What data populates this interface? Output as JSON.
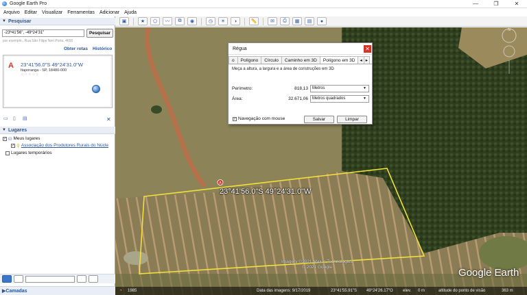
{
  "window": {
    "title": "Google Earth Pro",
    "controls": [
      "—",
      "❐",
      "✕"
    ]
  },
  "menubar": {
    "items": [
      "Arquivo",
      "Editar",
      "Visualizar",
      "Ferramentas",
      "Adicionar",
      "Ajuda"
    ]
  },
  "search": {
    "section_title": "Pesquisar",
    "input_value": "-23º41'56\", -49º24'31\"",
    "button_label": "Pesquisar",
    "hint": "por exemplo., Rua São Filipe Neri Porto, 4650",
    "get_directions": "Obter rotas",
    "history": "Histórico",
    "result": {
      "marker": "A",
      "title": "23°41'56.0\"S 49°24'31.0\"W",
      "address": "Itaporanga - SP, 18480-000",
      "rating_dots": "☆☆☆☆☆"
    }
  },
  "places": {
    "section_title": "Lugares",
    "my_places": "Meus lugares",
    "item": "Associação dos Produtores Rurais do Núcle",
    "temporary": "Lugares temporários"
  },
  "layers": {
    "section_title": "Camadas"
  },
  "map": {
    "coord_label": "23°41'56.0\"S 49°24'31.0\"W",
    "marker": "A",
    "credit_line1": "Imagery ©2021 Maxar Technologies",
    "credit_line2": "© 2021 Google",
    "logo": "Google Earth",
    "status": {
      "year": "1985",
      "image_date": "Data das imagens: 9/17/2019",
      "lat": "23°41'55.91\"S",
      "lon": "49°24'26.17\"O",
      "elev_label": "elev.",
      "elev": "0 m",
      "eye_alt": "altitude do ponto de visão",
      "eye_alt_value": "363 m"
    }
  },
  "ruler_dialog": {
    "title": "Régua",
    "tabs": [
      "o",
      "Polígono",
      "Círculo",
      "Caminho em 3D",
      "Polígono em 3D"
    ],
    "active_tab": "Polígono em 3D",
    "description": "Meça a altura, a largura e a área de construções em 3D",
    "perimeter_label": "Perímetro:",
    "perimeter_value": "818,13",
    "perimeter_unit": "Metros",
    "area_label": "Área:",
    "area_value": "32.671,06",
    "area_unit": "Metros quadrados",
    "nav_checkbox": "Navegação com mouse",
    "save_label": "Salvar",
    "clear_label": "Limpar"
  },
  "colors": {
    "polygon": "#f2e13a",
    "accent": "#2b5597",
    "close": "#d4332a"
  }
}
